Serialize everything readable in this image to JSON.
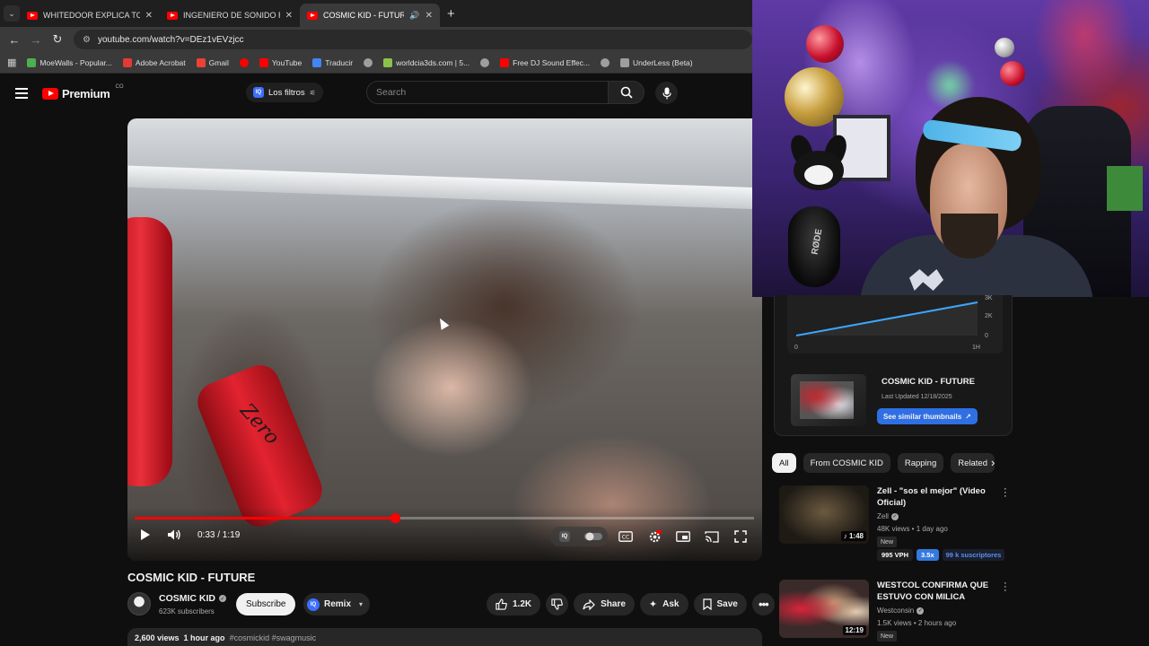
{
  "browser": {
    "tabs": [
      {
        "title": "WHITEDOOR EXPLICA TODO: S",
        "active": false
      },
      {
        "title": "INGENIERO DE SONIDO REACC",
        "active": false
      },
      {
        "title": "COSMIC KID - FUTURE - Yo",
        "active": true
      }
    ],
    "new_tab_glyph": "+",
    "url": "youtube.com/watch?v=DEz1vEVzjcc",
    "bookmarks": [
      {
        "label": "MoeWalls - Popular...",
        "color": "#4caf50"
      },
      {
        "label": "Adobe Acrobat",
        "color": "#e53935"
      },
      {
        "label": "Gmail",
        "color": "#ea4335"
      },
      {
        "label": "",
        "color": "#ff0000"
      },
      {
        "label": "YouTube",
        "color": "#ff0000"
      },
      {
        "label": "Traducir",
        "color": "#4285f4"
      },
      {
        "label": "",
        "color": "#9e9e9e"
      },
      {
        "label": "worldcia3ds.com | 5...",
        "color": "#8bc34a"
      },
      {
        "label": "",
        "color": "#9e9e9e"
      },
      {
        "label": "Free DJ Sound Effec...",
        "color": "#ff0000"
      },
      {
        "label": "",
        "color": "#9e9e9e"
      },
      {
        "label": "UnderLess (Beta)",
        "color": "#9e9e9e"
      }
    ]
  },
  "header": {
    "logo_text": "Premium",
    "country_code": "CO",
    "filters_label": "Los filtros",
    "iq_label": "IQ",
    "search_placeholder": "Search"
  },
  "player": {
    "current_time": "0:33 / 1:19",
    "progress": 0.42,
    "can_text": "Zero"
  },
  "video": {
    "title": "COSMIC KID - FUTURE",
    "channel": "COSMIC KID",
    "subscribers": "623K subscribers",
    "subscribe_label": "Subscribe",
    "remix_label": "Remix",
    "likes": "1.2K",
    "share_label": "Share",
    "ask_label": "Ask",
    "save_label": "Save",
    "views": "2,600 views",
    "age": "1 hour ago",
    "tags": "#cosmickid #swagmusic"
  },
  "stats_card": {
    "chart_ticks_y": [
      "3K",
      "2K",
      "0"
    ],
    "chart_ticks_x": [
      "0",
      "1H"
    ],
    "title": "COSMIC KID - FUTURE",
    "last_updated": "Last Updated 12/18/2025",
    "button_label": "See similar thumbnails"
  },
  "chips": [
    "All",
    "From COSMIC KID",
    "Rapping",
    "Related"
  ],
  "recommendations": [
    {
      "title": "Zell - \"sos el mejor\" (Video Oficial)",
      "channel": "Zell",
      "meta": "48K views • 1 day ago",
      "badge": "New",
      "duration": "1:48",
      "vph": "995 VPH",
      "mult": "3.5x",
      "subs": "99 k suscriptores"
    },
    {
      "title": "WESTCOL CONFIRMA QUE ESTUVO CON MILICA",
      "channel": "Westconsin",
      "meta": "1.5K views • 2 hours ago",
      "badge": "New",
      "duration": "12:19"
    }
  ],
  "colors": {
    "accent_red": "#ff0000",
    "accent_blue": "#2f6fe4",
    "background": "#0f0f0f"
  }
}
